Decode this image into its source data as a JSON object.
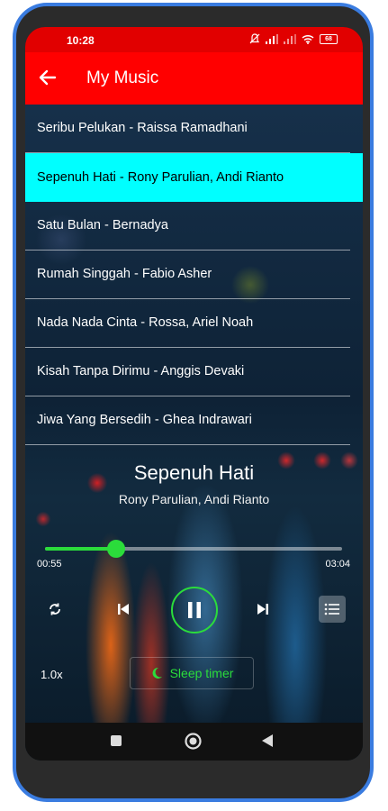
{
  "status_bar": {
    "time": "10:28",
    "battery": "68"
  },
  "app_bar": {
    "title": "My Music"
  },
  "playlist": [
    {
      "label": "Seribu Pelukan - Raissa Ramadhani",
      "active": false
    },
    {
      "label": "Sepenuh Hati - Rony Parulian, Andi Rianto",
      "active": true
    },
    {
      "label": "Satu Bulan - Bernadya",
      "active": false
    },
    {
      "label": "Rumah Singgah - Fabio Asher",
      "active": false
    },
    {
      "label": "Nada Nada Cinta - Rossa, Ariel Noah",
      "active": false
    },
    {
      "label": "Kisah Tanpa Dirimu - Anggis Devaki",
      "active": false
    },
    {
      "label": "Jiwa Yang Bersedih - Ghea Indrawari",
      "active": false
    }
  ],
  "now_playing": {
    "title": "Sepenuh Hati",
    "artist": "Rony Parulian, Andi Rianto",
    "current_time": "00:55",
    "total_time": "03:04",
    "progress_fraction": 0.24
  },
  "controls": {
    "speed": "1.0x",
    "sleep_timer_label": "Sleep timer"
  },
  "colors": {
    "accent": "#2bdc3b",
    "app_bar": "#ff0000",
    "status_bar": "#e10000",
    "active_row": "#00ffff",
    "phone_frame": "#3a7ce0"
  },
  "icons": [
    "back-arrow-icon",
    "repeat-icon",
    "skip-previous-icon",
    "pause-icon",
    "skip-next-icon",
    "playlist-icon",
    "moon-icon",
    "nav-recents-icon",
    "nav-home-icon",
    "nav-back-icon"
  ]
}
